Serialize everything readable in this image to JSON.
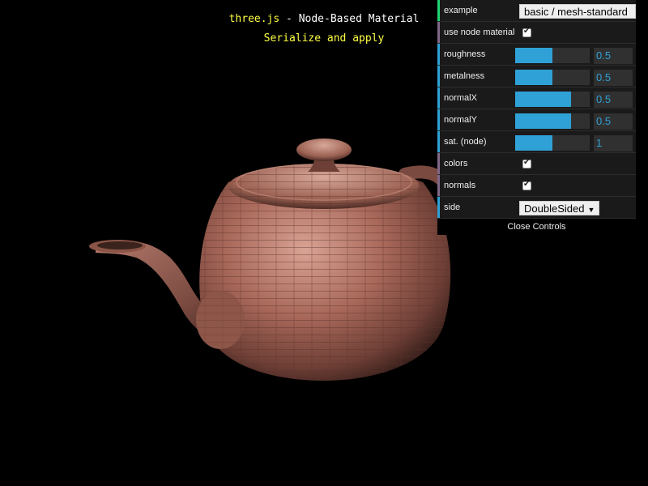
{
  "header": {
    "link_text": "three.js",
    "title_rest": " - Node-Based Material",
    "subtitle": "Serialize and apply"
  },
  "gui": {
    "example": {
      "label": "example",
      "value": "basic / mesh-standard"
    },
    "use_node_material": {
      "label": "use node material",
      "checked": true
    },
    "roughness": {
      "label": "roughness",
      "value": "0.5",
      "fraction": 0.5
    },
    "metalness": {
      "label": "metalness",
      "value": "0.5",
      "fraction": 0.5
    },
    "normalX": {
      "label": "normalX",
      "value": "0.5",
      "fraction": 0.75
    },
    "normalY": {
      "label": "normalY",
      "value": "0.5",
      "fraction": 0.75
    },
    "sat_node": {
      "label": "sat. (node)",
      "value": "1",
      "fraction": 0.5
    },
    "colors": {
      "label": "colors",
      "checked": true
    },
    "normals": {
      "label": "normals",
      "checked": true
    },
    "side": {
      "label": "side",
      "value": "DoubleSided"
    },
    "close_label": "Close Controls"
  },
  "colors": {
    "accent": "#2fa1d6",
    "checkbox_bar": "#806787",
    "example_bar": "#1ed36f",
    "header_link": "#ffff44",
    "copper": "#a8685a"
  }
}
